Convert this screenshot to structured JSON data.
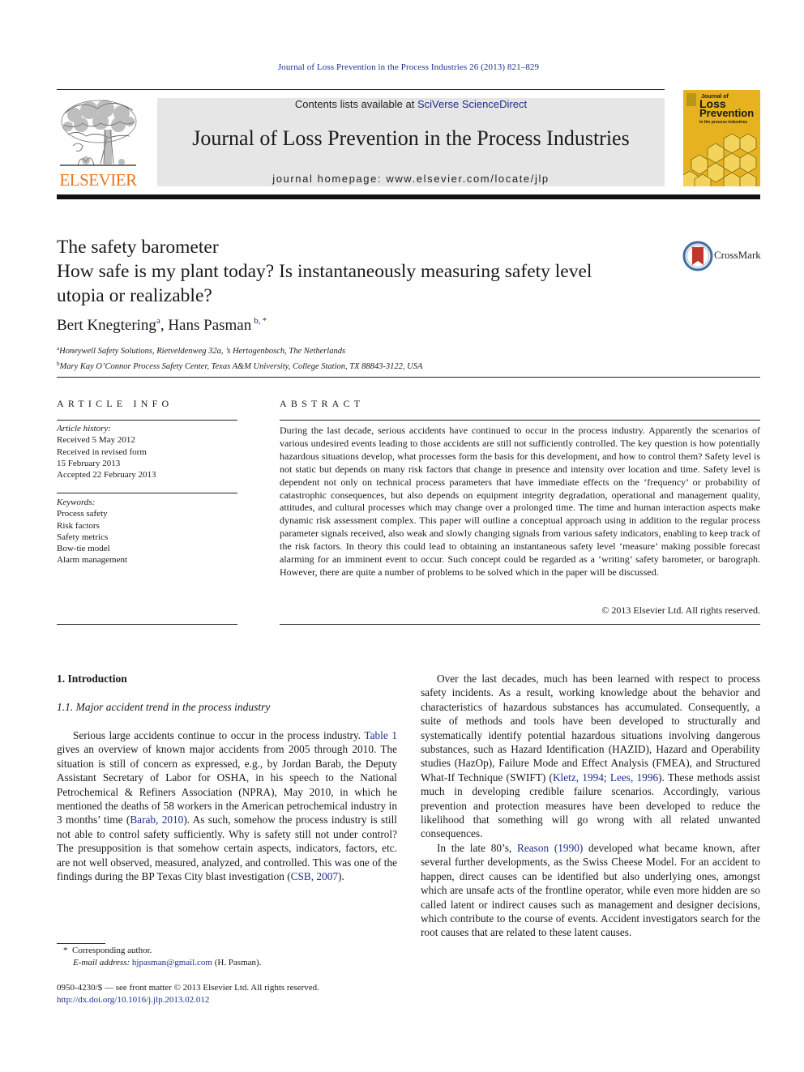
{
  "header": {
    "running_head": "Journal of Loss Prevention in the Process Industries 26 (2013) 821–829",
    "contents_prefix": "Contents lists available at ",
    "contents_link": "SciVerse ScienceDirect",
    "journal_title": "Journal of Loss Prevention in the Process Industries",
    "homepage_prefix": "journal homepage: ",
    "homepage_url": "www.elsevier.com/locate/jlp",
    "publisher_logo_text": "ELSEVIER",
    "publisher_color": "#e87722",
    "cover": {
      "line1": "Journal of",
      "line2": "Loss",
      "line3": "Prevention",
      "line4": "in the process industries",
      "color": "#e7b21f"
    }
  },
  "article": {
    "title_line1": "The safety barometer",
    "title_line2": "How safe is my plant today? Is instantaneously measuring safety level",
    "title_line3": "utopia or realizable?",
    "crossmark_label": "CrossMark",
    "authors": [
      {
        "name": "Bert Knegtering",
        "sup": "a"
      },
      {
        "name": "Hans Pasman",
        "sup": "b, *"
      }
    ],
    "author_separator": ", ",
    "affiliations": [
      {
        "sup": "a",
        "text": "Honeywell Safety Solutions, Rietveldenweg 32a, ’s Hertogenbosch, The Netherlands"
      },
      {
        "sup": "b",
        "text": "Mary Kay O’Connor Process Safety Center, Texas A&M University, College Station, TX 88843-3122, USA"
      }
    ]
  },
  "article_info": {
    "heading": "ARTICLE INFO",
    "history_label": "Article history:",
    "history": [
      "Received 5 May 2012",
      "Received in revised form",
      "15 February 2013",
      "Accepted 22 February 2013"
    ],
    "keywords_label": "Keywords:",
    "keywords": [
      "Process safety",
      "Risk factors",
      "Safety metrics",
      "Bow-tie model",
      "Alarm management"
    ]
  },
  "abstract": {
    "heading": "ABSTRACT",
    "text": "During the last decade, serious accidents have continued to occur in the process industry. Apparently the scenarios of various undesired events leading to those accidents are still not sufficiently controlled. The key question is how potentially hazardous situations develop, what processes form the basis for this development, and how to control them? Safety level is not static but depends on many risk factors that change in presence and intensity over location and time. Safety level is dependent not only on technical process parameters that have immediate effects on the ‘frequency’ or probability of catastrophic con­sequences, but also depends on equipment integrity degradation, operational and management quality, attitudes, and cultural processes which may change over a prolonged time. The time and human interaction aspects make dynamic risk assessment complex. This paper will outline a conceptual approach using in addition to the regular process parameter signals received, also weak and slowly changing signals from various safety indicators, enabling to keep track of the risk factors. In theory this could lead to obtaining an instantaneous safety level ‘measure’ making possible forecast alarming for an imminent event to occur. Such concept could be regarded as a ‘writing’ safety barometer, or barograph. However, there are quite a number of problems to be solved which in the paper will be discussed.",
    "copyright": "© 2013 Elsevier Ltd. All rights reserved."
  },
  "body": {
    "section1_heading": "1.  Introduction",
    "subsection1_heading": "1.1.  Major accident trend in the process industry",
    "left_para": {
      "t1": "Serious large accidents continue to occur in the process in­dustry. ",
      "link1": "Table 1",
      "t2": " gives an overview of known major accidents from 2005 through 2010. The situation is still of concern as expressed, e.g., by Jordan Barab, the Deputy Assistant Secretary of Labor for OSHA, in his speech to the National Petrochemical & Refiners As­sociation (NPRA), May 2010, in which he mentioned the deaths of 58 workers in the American petrochemical industry in 3 months’ time (",
      "link2": "Barab, 2010",
      "t3": "). As such, somehow the process industry is still not able to control safety sufficiently. Why is safety still not under control? The presupposition is that somehow certain aspects, in­dicators, factors, etc. are not well observed, measured, analyzed, and controlled. This was one of the findings during the BP Texas City blast investigation (",
      "link3": "CSB, 2007",
      "t4": ")."
    },
    "right_para1": {
      "t1": "Over the last decades, much has been learned with respect to process safety incidents. As a result, working knowledge about the behavior and characteristics of hazardous substances has accu­mulated. Consequently, a suite of methods and tools have been developed to structurally and systematically identify potential hazardous situations involving dangerous substances, such as Hazard Identification (HAZID), Hazard and Operability studies (HazOp), Failure Mode and Effect Analysis (FMEA), and Structured What-If Technique (SWIFT) (",
      "link1": "Kletz, 1994",
      "t2": "; ",
      "link2": "Lees, 1996",
      "t3": "). These methods assist much in developing credible failure scenarios. Accordingly, various prevention and protection measures have been developed to reduce the likelihood that something will go wrong with all related unwanted consequences."
    },
    "right_para2": {
      "t1": "In the late 80’s, ",
      "link1": "Reason (1990)",
      "t2": " developed what became known, after several further developments, as the Swiss Cheese Model. For an accident to happen, direct causes can be identified but also underlying ones, amongst which are unsafe acts of the frontline operator, while even more hidden are so called latent or indirect causes such as management and designer decisions, which contribute to the course of events. Accident investigators search for the root causes that are related to these latent causes."
    }
  },
  "footnotes": {
    "star": "*",
    "corresponding": "Corresponding author.",
    "email_label": "E-mail address:",
    "email": "hjpasman@gmail.com",
    "email_suffix": " (H. Pasman).",
    "front_matter": "0950-4230/$ — see front matter © 2013 Elsevier Ltd. All rights reserved.",
    "doi": "http://dx.doi.org/10.1016/j.jlp.2013.02.012"
  },
  "colors": {
    "link": "#1f2f8a",
    "banner_bg": "#e6e6e6"
  }
}
